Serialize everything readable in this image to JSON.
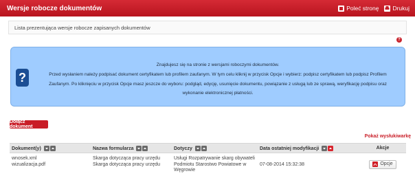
{
  "header": {
    "title": "Wersje robocze dokumentów",
    "recommend_label": "Poleć stronę",
    "print_label": "Drukuj"
  },
  "description": "Lista prezentująca wersje robocze zapisanych dokumentów",
  "info": {
    "lines": [
      "Znajdujesz się na stronie z wersjami roboczymi dokumentów.",
      "Przed wysłaniem należy podpisać dokument certyfikatem lub profilem zaufanym. W tym celu kliknij w przycisk Opcje i wybierz: podpisz certyfikatem lub podpisz Profilem",
      "Zaufanym. Po kliknięciu w przycisk Opcje masz jeszcze do wyboru: podgląd, edycję, usunięcie dokumentu, powiązanie z usługą lub ze sprawą, weryfikację podpisu oraz",
      "wykonanie elektronicznej płatności."
    ]
  },
  "add_button": "Dołącz dokument",
  "show_deleted": "Pokaż wysłukiwarkę",
  "table": {
    "headers": [
      "Dokument(y)",
      "Nazwa formularza",
      "Dotyczy",
      "Data ostatniej modyfikacji",
      "Akcje"
    ],
    "rows": [
      {
        "documents": [
          "wnosek.xml",
          "wizualizacja.pdf"
        ],
        "form_names": [
          "Skarga dotycząca pracy urzędu",
          "Skarga dotycząca pracy urzędu"
        ],
        "concerns": [
          "Usługi Rozpatrywanie skarg obywateli",
          "Podmiotu Starostwo Powiatowe w",
          "Węgrowie"
        ],
        "modified": "07-08-2014 15:32:38",
        "action_label": "Opcje"
      }
    ]
  },
  "colors": {
    "header_red": "#c91d27",
    "info_blue": "#9fccff",
    "info_icon": "#1b4e94"
  }
}
